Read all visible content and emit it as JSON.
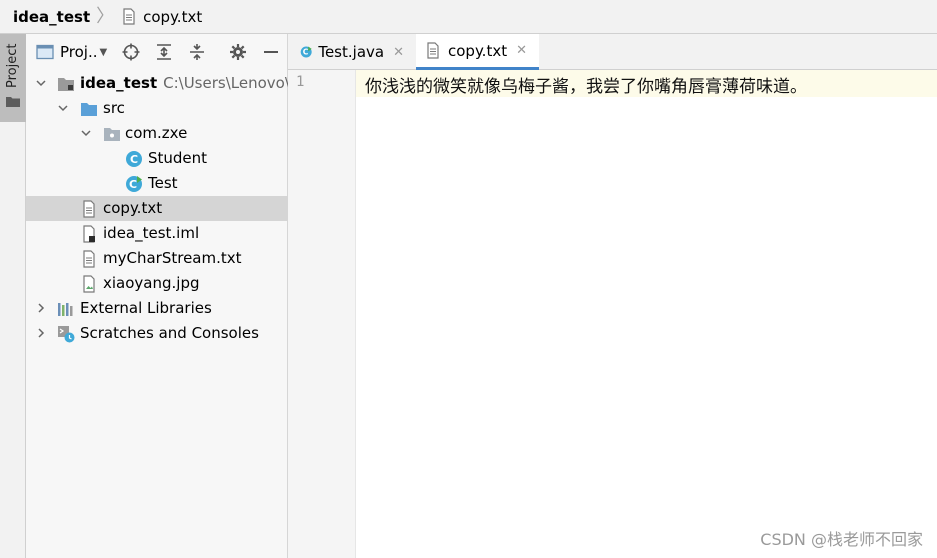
{
  "breadcrumb": {
    "project": "idea_test",
    "file": "copy.txt"
  },
  "tool_window_strip": {
    "label": "Project"
  },
  "project_panel": {
    "selector_label": "Proj..",
    "toolbar_icons": [
      "crosshair-icon",
      "expand-all-icon",
      "collapse-all-icon",
      "gear-icon",
      "minimize-icon"
    ],
    "tree": {
      "root_name": "idea_test",
      "root_path": "C:\\Users\\Lenovo\\D",
      "src": "src",
      "package": "com.zxe",
      "class_student": "Student",
      "class_test": "Test",
      "file_copy": "copy.txt",
      "file_iml": "idea_test.iml",
      "file_stream": "myCharStream.txt",
      "file_image": "xiaoyang.jpg",
      "external_libraries": "External Libraries",
      "scratches": "Scratches and Consoles"
    }
  },
  "editor": {
    "tabs": [
      {
        "label": "Test.java",
        "active": false
      },
      {
        "label": "copy.txt",
        "active": true
      }
    ],
    "line_number": "1",
    "line_text": "你浅浅的微笑就像乌梅子酱，我尝了你嘴角唇膏薄荷味道。"
  },
  "watermark": "CSDN @栈老师不回家",
  "colors": {
    "accent": "#4083c9",
    "java_class": "#3fa9d8",
    "folder_blue": "#5aa0d8",
    "selection": "#d5d5d5"
  }
}
